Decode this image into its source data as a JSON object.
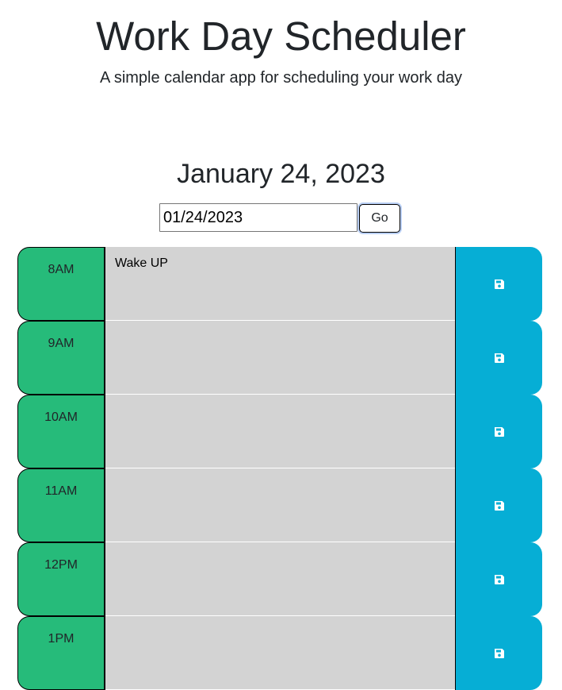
{
  "header": {
    "title": "Work Day Scheduler",
    "subtitle": "A simple calendar app for scheduling your work day"
  },
  "date_picker": {
    "display_date": "January 24, 2023",
    "input_value": "01/24/2023",
    "go_label": "Go"
  },
  "schedule": {
    "blocks": [
      {
        "hour": "8AM",
        "text": "Wake UP"
      },
      {
        "hour": "9AM",
        "text": ""
      },
      {
        "hour": "10AM",
        "text": ""
      },
      {
        "hour": "11AM",
        "text": ""
      },
      {
        "hour": "12PM",
        "text": ""
      },
      {
        "hour": "1PM",
        "text": ""
      }
    ]
  },
  "colors": {
    "hour_block": "#26bb7a",
    "description_past": "#d3d3d3",
    "save_button": "#06aed5",
    "save_icon": "#ffffff"
  },
  "icons": {
    "save": "floppy-disk-icon"
  }
}
